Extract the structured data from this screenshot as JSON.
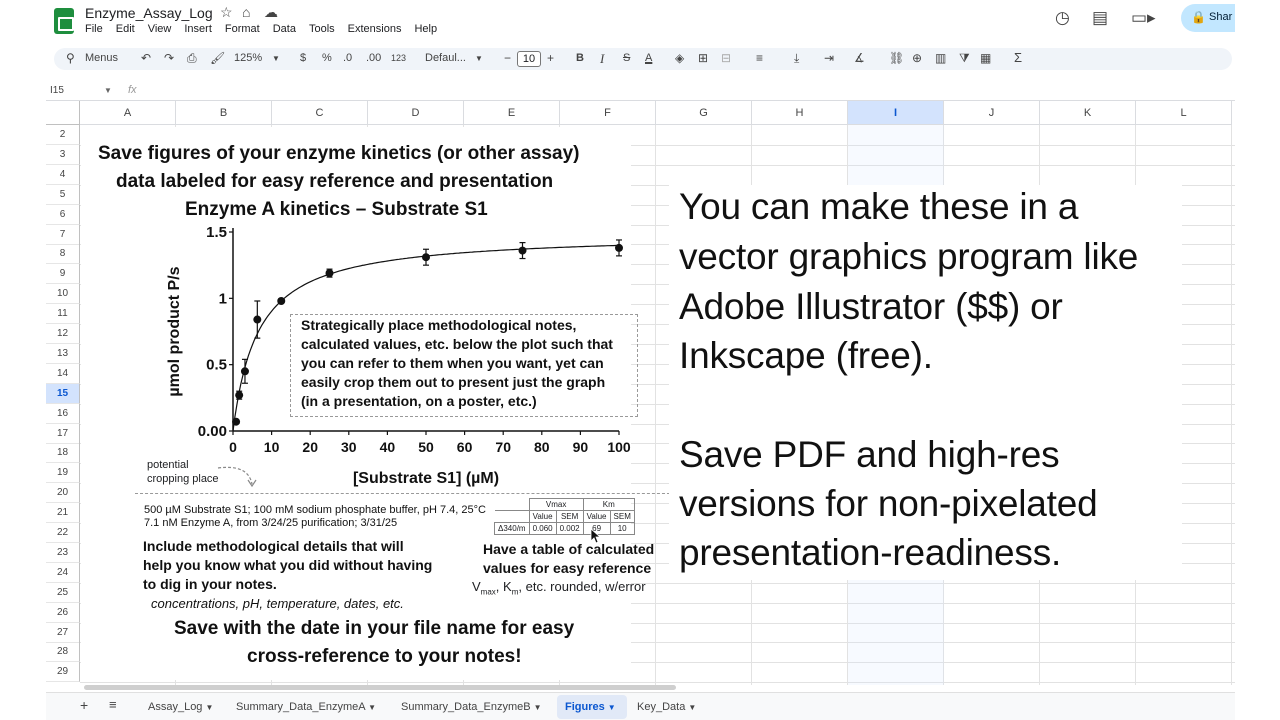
{
  "app": {
    "doc_title": "Enzyme_Assay_Log",
    "menus": [
      "File",
      "Edit",
      "View",
      "Insert",
      "Format",
      "Data",
      "Tools",
      "Extensions",
      "Help"
    ],
    "share_label": "Shar",
    "accent": "#0b57d0",
    "brand_green": "#1e8e3e"
  },
  "toolbar": {
    "menus_label": "Menus",
    "zoom": "125%",
    "currency": "$",
    "percent": "%",
    "dec_decrease": ".0",
    "dec_increase": ".00",
    "num_format": "123",
    "font": "Defaul...",
    "font_size": "10",
    "bold": "B",
    "italic": "I",
    "strike": "S",
    "text_color": "A",
    "sum": "Σ"
  },
  "formula_bar": {
    "cell_ref": "I15",
    "fx": "fx"
  },
  "columns": [
    "A",
    "B",
    "C",
    "D",
    "E",
    "F",
    "G",
    "H",
    "I",
    "J",
    "K",
    "L"
  ],
  "selected_column": "I",
  "rows": [
    "2",
    "3",
    "4",
    "5",
    "6",
    "7",
    "8",
    "9",
    "10",
    "11",
    "12",
    "13",
    "14",
    "15",
    "16",
    "17",
    "18",
    "19",
    "20",
    "21",
    "22",
    "23",
    "24",
    "25",
    "26",
    "27",
    "28",
    "29"
  ],
  "selected_row": "15",
  "figure": {
    "heading_1": "Save figures of your enzyme kinetics (or other assay)",
    "heading_2": "data labeled for easy reference and presentation",
    "plot_title": "Enzyme A kinetics – Substrate S1",
    "note_box": [
      "Strategically place methodological notes,",
      "calculated values, etc. below the plot such that",
      "you can refer to them when you want, yet can",
      "easily crop them out to present just the graph",
      "(in a presentation, on a poster, etc.)"
    ],
    "crop_note": [
      "potential",
      "cropping place"
    ],
    "methods_line_1": "500 µM Substrate S1; 100 mM sodium phosphate buffer, pH 7.4, 25°C",
    "methods_line_2": "7.1 nM Enzyme A, from 3/24/25 purification; 3/31/25",
    "methods_bold": [
      "Include methodological details that will",
      "help you know what you did without having",
      "to dig in your notes."
    ],
    "methods_italic": "concentrations, pH, temperature, dates, etc.",
    "table_note": [
      "Have a table of calculated",
      "values for easy reference"
    ],
    "table_note_vmax": "V",
    "table_note_vmax_sub": "max",
    "table_note_km": ", K",
    "table_note_km_sub": "m",
    "table_note_rest": ", etc. rounded, w/error",
    "table": {
      "group_headers": [
        "Vmax",
        "Km"
      ],
      "sub_headers": [
        "Value",
        "SEM",
        "Value",
        "SEM"
      ],
      "row_label": "Δ340/m",
      "row_values": [
        "0.060",
        "0.002",
        "69",
        "10"
      ]
    },
    "footer": [
      "Save with the date in your file name for easy",
      "cross-reference to your notes!"
    ]
  },
  "chart_data": {
    "type": "scatter",
    "title": "Enzyme A kinetics – Substrate S1",
    "xlabel": "[Substrate S1] (µM)",
    "ylabel": "µmol product P/s",
    "xlim": [
      0,
      100
    ],
    "ylim": [
      0,
      1.5
    ],
    "x_ticks": [
      "0",
      "10",
      "20",
      "30",
      "40",
      "50",
      "60",
      "70",
      "80",
      "90",
      "100"
    ],
    "y_ticks": [
      "0.00",
      "0.5",
      "1",
      "1.5"
    ],
    "points": [
      {
        "x": 0.8,
        "y": 0.07,
        "err": 0.0
      },
      {
        "x": 1.6,
        "y": 0.27,
        "err": 0.03
      },
      {
        "x": 3.1,
        "y": 0.45,
        "err": 0.09
      },
      {
        "x": 6.3,
        "y": 0.84,
        "err": 0.14
      },
      {
        "x": 12.5,
        "y": 0.98,
        "err": 0.0
      },
      {
        "x": 25,
        "y": 1.19,
        "err": 0.03
      },
      {
        "x": 50,
        "y": 1.31,
        "err": 0.06
      },
      {
        "x": 75,
        "y": 1.36,
        "err": 0.06
      },
      {
        "x": 100,
        "y": 1.38,
        "err": 0.06
      }
    ],
    "fit": {
      "vmax": 1.49,
      "km": 6.5
    },
    "grid": false
  },
  "overlay": {
    "lines": [
      "You can make these in a",
      "vector graphics program like",
      "Adobe Illustrator ($$) or",
      "Inkscape (free).",
      "",
      "Save PDF and high-res",
      "versions for non-pixelated",
      "presentation-readiness."
    ]
  },
  "sheets": [
    "Assay_Log",
    "Summary_Data_EnzymeA",
    "Summary_Data_EnzymeB",
    "Figures",
    "Key_Data"
  ],
  "active_sheet": "Figures"
}
